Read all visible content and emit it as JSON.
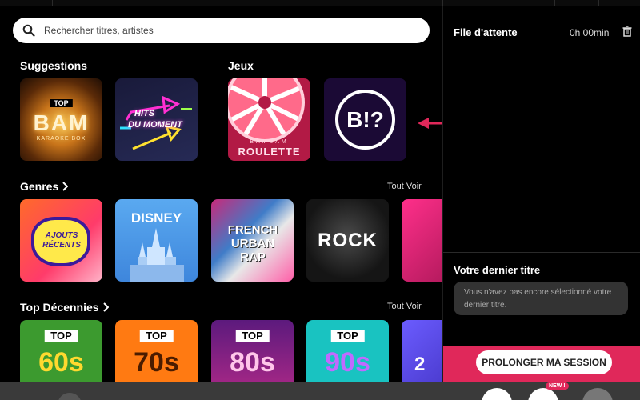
{
  "search": {
    "placeholder": "Rechercher titres, artistes"
  },
  "sections": {
    "suggestions": "Suggestions",
    "games": "Jeux",
    "genres": "Genres",
    "decades": "Top Décennies",
    "see_all": "Tout Voir"
  },
  "suggestions": {
    "bam": {
      "badge": "TOP",
      "big": "BAM",
      "sub": "KARAOKE BOX"
    },
    "hits": {
      "line1": "HITS",
      "line2": "DU MOMENT"
    }
  },
  "games": {
    "roulette": {
      "line1": "BAMBAM",
      "line2": "ROULETTE"
    },
    "quiz": {
      "logo": "B!?"
    }
  },
  "genres": [
    "AJOUTS RÉCENTS",
    "DISNEY",
    "FRENCH URBAN RAP",
    "ROCK"
  ],
  "decades": {
    "badge": "TOP",
    "items": [
      "60s",
      "70s",
      "80s",
      "90s",
      "2"
    ]
  },
  "queue": {
    "title": "File d'attente",
    "duration": "0h 00min"
  },
  "last_song": {
    "title": "Votre dernier titre",
    "empty": "Vous n'avez pas encore sélectionné votre dernier titre."
  },
  "extend_button": "PROLONGER MA SESSION",
  "bottom": {
    "new_badge": "NEW !"
  },
  "colors": {
    "accent": "#e0285a",
    "arrow": "#e0285a"
  }
}
